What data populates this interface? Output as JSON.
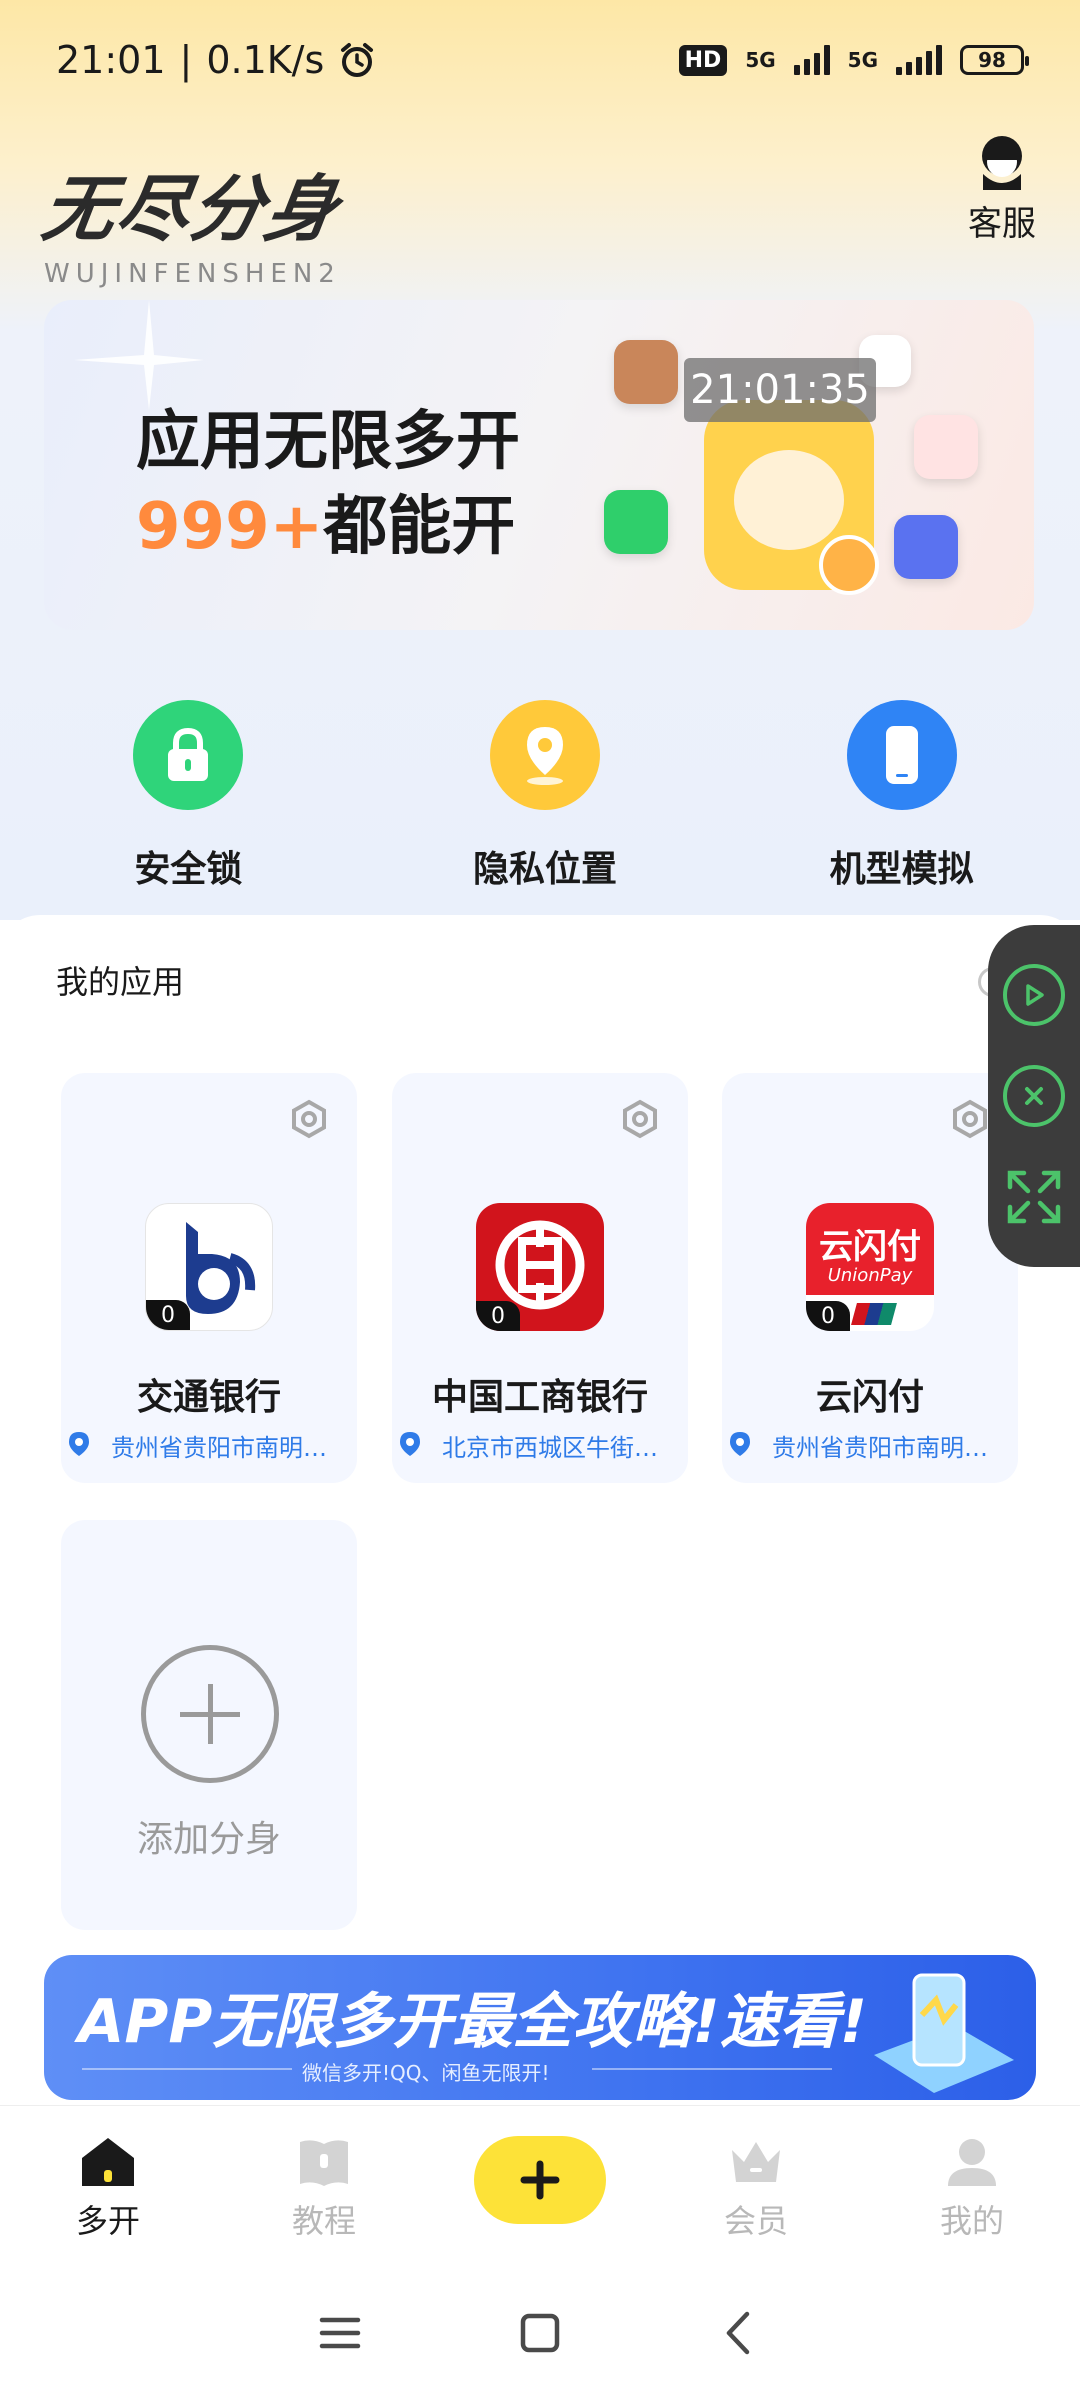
{
  "status_bar": {
    "time": "21:01",
    "speed": "0.1K/s",
    "network_badge": "HD",
    "net_label_1": "5G",
    "net_label_2": "5G",
    "battery": "98"
  },
  "header": {
    "brand_title": "无尽分身",
    "brand_subtitle": "WUJINFENSHEN2",
    "service_label": "客服"
  },
  "banner": {
    "line1": "应用无限多开",
    "line2_highlight": "999+",
    "line2_rest": "都能开",
    "clock": "21:01:35"
  },
  "features": [
    {
      "label": "安全锁",
      "icon": "lock-icon",
      "color": "#2fd47a"
    },
    {
      "label": "隐私位置",
      "icon": "location-icon",
      "color": "#ffc93a"
    },
    {
      "label": "机型模拟",
      "icon": "phone-icon",
      "color": "#2f84f5"
    }
  ],
  "apps_section": {
    "title": "我的应用",
    "apps": [
      {
        "name": "交通银行",
        "count": "0",
        "location": "贵州省贵阳市南明区..."
      },
      {
        "name": "中国工商银行",
        "count": "0",
        "location": "北京市西城区牛街街..."
      },
      {
        "name": "云闪付",
        "count": "0",
        "location": "贵州省贵阳市南明区...",
        "icon_text": "云闪付",
        "icon_subtext": "UnionPay"
      }
    ],
    "add_label": "添加分身"
  },
  "promo": {
    "title": "APP无限多开最全攻略!速看!",
    "subtitle": "微信多开!QQ、闲鱼无限开!"
  },
  "tabbar": {
    "tabs": [
      {
        "label": "多开",
        "icon": "home-icon",
        "active": true
      },
      {
        "label": "教程",
        "icon": "book-icon",
        "active": false
      },
      {
        "label": "",
        "icon": "plus-icon",
        "active": false
      },
      {
        "label": "会员",
        "icon": "crown-icon",
        "active": false
      },
      {
        "label": "我的",
        "icon": "user-icon",
        "active": false
      }
    ]
  },
  "colors": {
    "accent_yellow": "#fde238",
    "link_blue": "#2f7be8",
    "highlight_orange": "#ff8a3d",
    "control_green": "#4cc36a"
  }
}
